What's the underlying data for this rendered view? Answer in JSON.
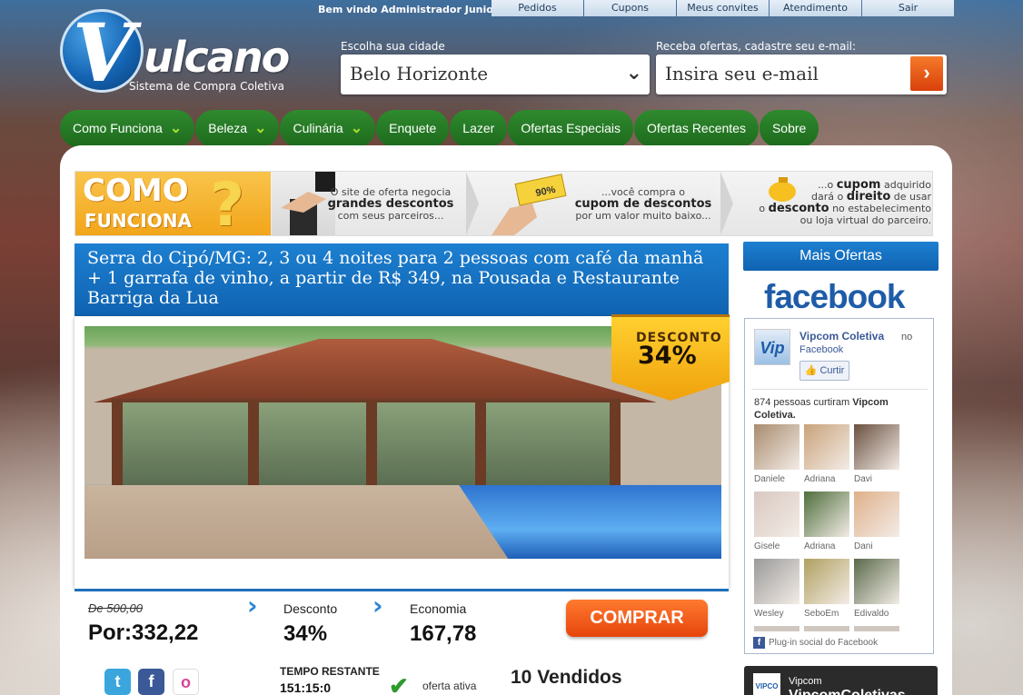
{
  "topbar": {
    "welcome_prefix": "Bem vindo",
    "welcome_user": "Administrador Junio",
    "links": [
      "Pedidos",
      "Cupons",
      "Meus convites",
      "Atendimento",
      "Sair"
    ]
  },
  "logo": {
    "letter": "V",
    "word": "ulcano",
    "tagline": "Sistema de Compra Coletiva"
  },
  "city": {
    "label": "Escolha sua cidade",
    "value": "Belo Horizonte"
  },
  "newsletter": {
    "label": "Receba ofertas, cadastre seu e-mail:",
    "placeholder": "Insira seu e-mail",
    "button": "›"
  },
  "nav": [
    {
      "label": "Como Funciona",
      "dropdown": true
    },
    {
      "label": "Beleza",
      "dropdown": true
    },
    {
      "label": "Culinária",
      "dropdown": true
    },
    {
      "label": "Enquete",
      "dropdown": false
    },
    {
      "label": "Lazer",
      "dropdown": false
    },
    {
      "label": "Ofertas Especiais",
      "dropdown": false
    },
    {
      "label": "Ofertas Recentes",
      "dropdown": false
    },
    {
      "label": "Sobre",
      "dropdown": false
    }
  ],
  "how_it_works": {
    "title_l1": "COMO",
    "title_l2": "FUNCIONA",
    "step1": {
      "pre": "O site de oferta negocia",
      "bold": "grandes descontos",
      "post": "com seus parceiros..."
    },
    "step2": {
      "pre": "...você compra o",
      "bold": "cupom de descontos",
      "post": "por um valor muito baixo...",
      "coupon_text": "90%"
    },
    "step3": {
      "l1a": "...o",
      "l1b": "cupom",
      "l1c": "adquirido",
      "l2a": "dará o",
      "l2b": "direito",
      "l2c": "de usar",
      "l3a": "o",
      "l3b": "desconto",
      "l3c": "no estabelecimento",
      "l4": "ou loja virtual do parceiro."
    }
  },
  "deal": {
    "title": "Serra do Cipó/MG: 2, 3 ou 4 noites para 2 pessoas com café da manhã + 1 garrafa de vinho, a partir de R$ 349, na Pousada e Restaurante Barriga da Lua",
    "badge_label": "DESCONTO",
    "badge_value": "34%",
    "old_price": "De 500,00",
    "price": "Por:332,22",
    "discount_label": "Desconto",
    "discount_value": "34%",
    "savings_label": "Economia",
    "savings_value": "167,78",
    "buy_label": "COMPRAR",
    "time_label": "TEMPO RESTANTE",
    "time_value": "151:15:0",
    "status": "oferta ativa",
    "sold": "10 Vendidos"
  },
  "sidebar": {
    "mais_ofertas": "Mais Ofertas",
    "facebook_logo": "facebook",
    "page_name": "Vipcom Coletiva",
    "page_no": "no",
    "page_fb": "Facebook",
    "like_button": "Curtir",
    "fans_count_text": "874 pessoas curtiram",
    "fans_page": "Vipcom Coletiva.",
    "fans": [
      {
        "name": "Daniele",
        "color": "#a88b6e"
      },
      {
        "name": "Adriana",
        "color": "#c9a27a"
      },
      {
        "name": "Davi",
        "color": "#6b5040"
      },
      {
        "name": "Gisele",
        "color": "#d8c8c0"
      },
      {
        "name": "Adriana",
        "color": "#4f6e3c"
      },
      {
        "name": "Dani",
        "color": "#e0b08a"
      },
      {
        "name": "Wesley",
        "color": "#9a9a9a"
      },
      {
        "name": "SeboEm",
        "color": "#b0a060"
      },
      {
        "name": "Edivaldo",
        "color": "#5a6a4a"
      }
    ],
    "plugin_text": "Plug-in social do Facebook",
    "vip_small": "Vipcom",
    "vip_big": "VipcomColetivas",
    "vip_thumb": "VIPCO"
  },
  "social": [
    {
      "name": "twitter",
      "glyph": "t",
      "color": "#3aa6dd"
    },
    {
      "name": "facebook",
      "glyph": "f",
      "color": "#3b5998"
    },
    {
      "name": "orkut",
      "glyph": "o",
      "color": "#d8449a"
    }
  ]
}
